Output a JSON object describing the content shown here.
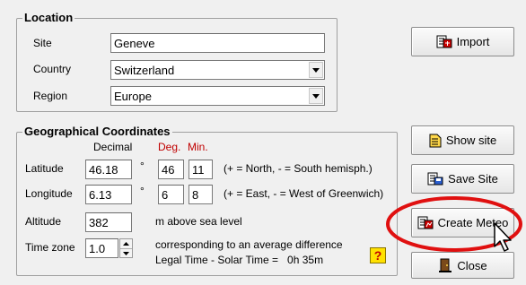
{
  "location": {
    "legend": "Location",
    "site_label": "Site",
    "site_value": "Geneve",
    "country_label": "Country",
    "country_value": "Switzerland",
    "region_label": "Region",
    "region_value": "Europe"
  },
  "geo": {
    "legend": "Geographical Coordinates",
    "col_decimal": "Decimal",
    "col_deg": "Deg.",
    "col_min": "Min.",
    "latitude_label": "Latitude",
    "latitude_decimal": "46.18",
    "latitude_deg": "46",
    "latitude_min": "11",
    "latitude_hint": "(+ = North,  - = South hemisph.)",
    "longitude_label": "Longitude",
    "longitude_decimal": "6.13",
    "longitude_deg": "6",
    "longitude_min": "8",
    "longitude_hint": "(+ = East, - = West of Greenwich)",
    "degree_symbol": "°",
    "altitude_label": "Altitude",
    "altitude_value": "382",
    "altitude_unit": "m above sea level",
    "timezone_label": "Time zone",
    "timezone_value": "1.0",
    "timezone_note_1": "corresponding to an average difference",
    "timezone_note_2": "Legal Time - Solar Time =   0h 35m",
    "help_label": "?"
  },
  "buttons": {
    "import": "Import",
    "show_site": "Show site",
    "save_site": "Save Site",
    "create_meteo": "Create Meteo",
    "close": "Close"
  },
  "colors": {
    "highlight_ellipse": "#e01010",
    "accent_red": "#c00000"
  },
  "icons": {
    "import": "import-icon",
    "show_site": "document-icon",
    "save_site": "save-icon",
    "create_meteo": "meteo-icon",
    "close": "door-close-icon",
    "cursor": "mouse-pointer-icon"
  }
}
